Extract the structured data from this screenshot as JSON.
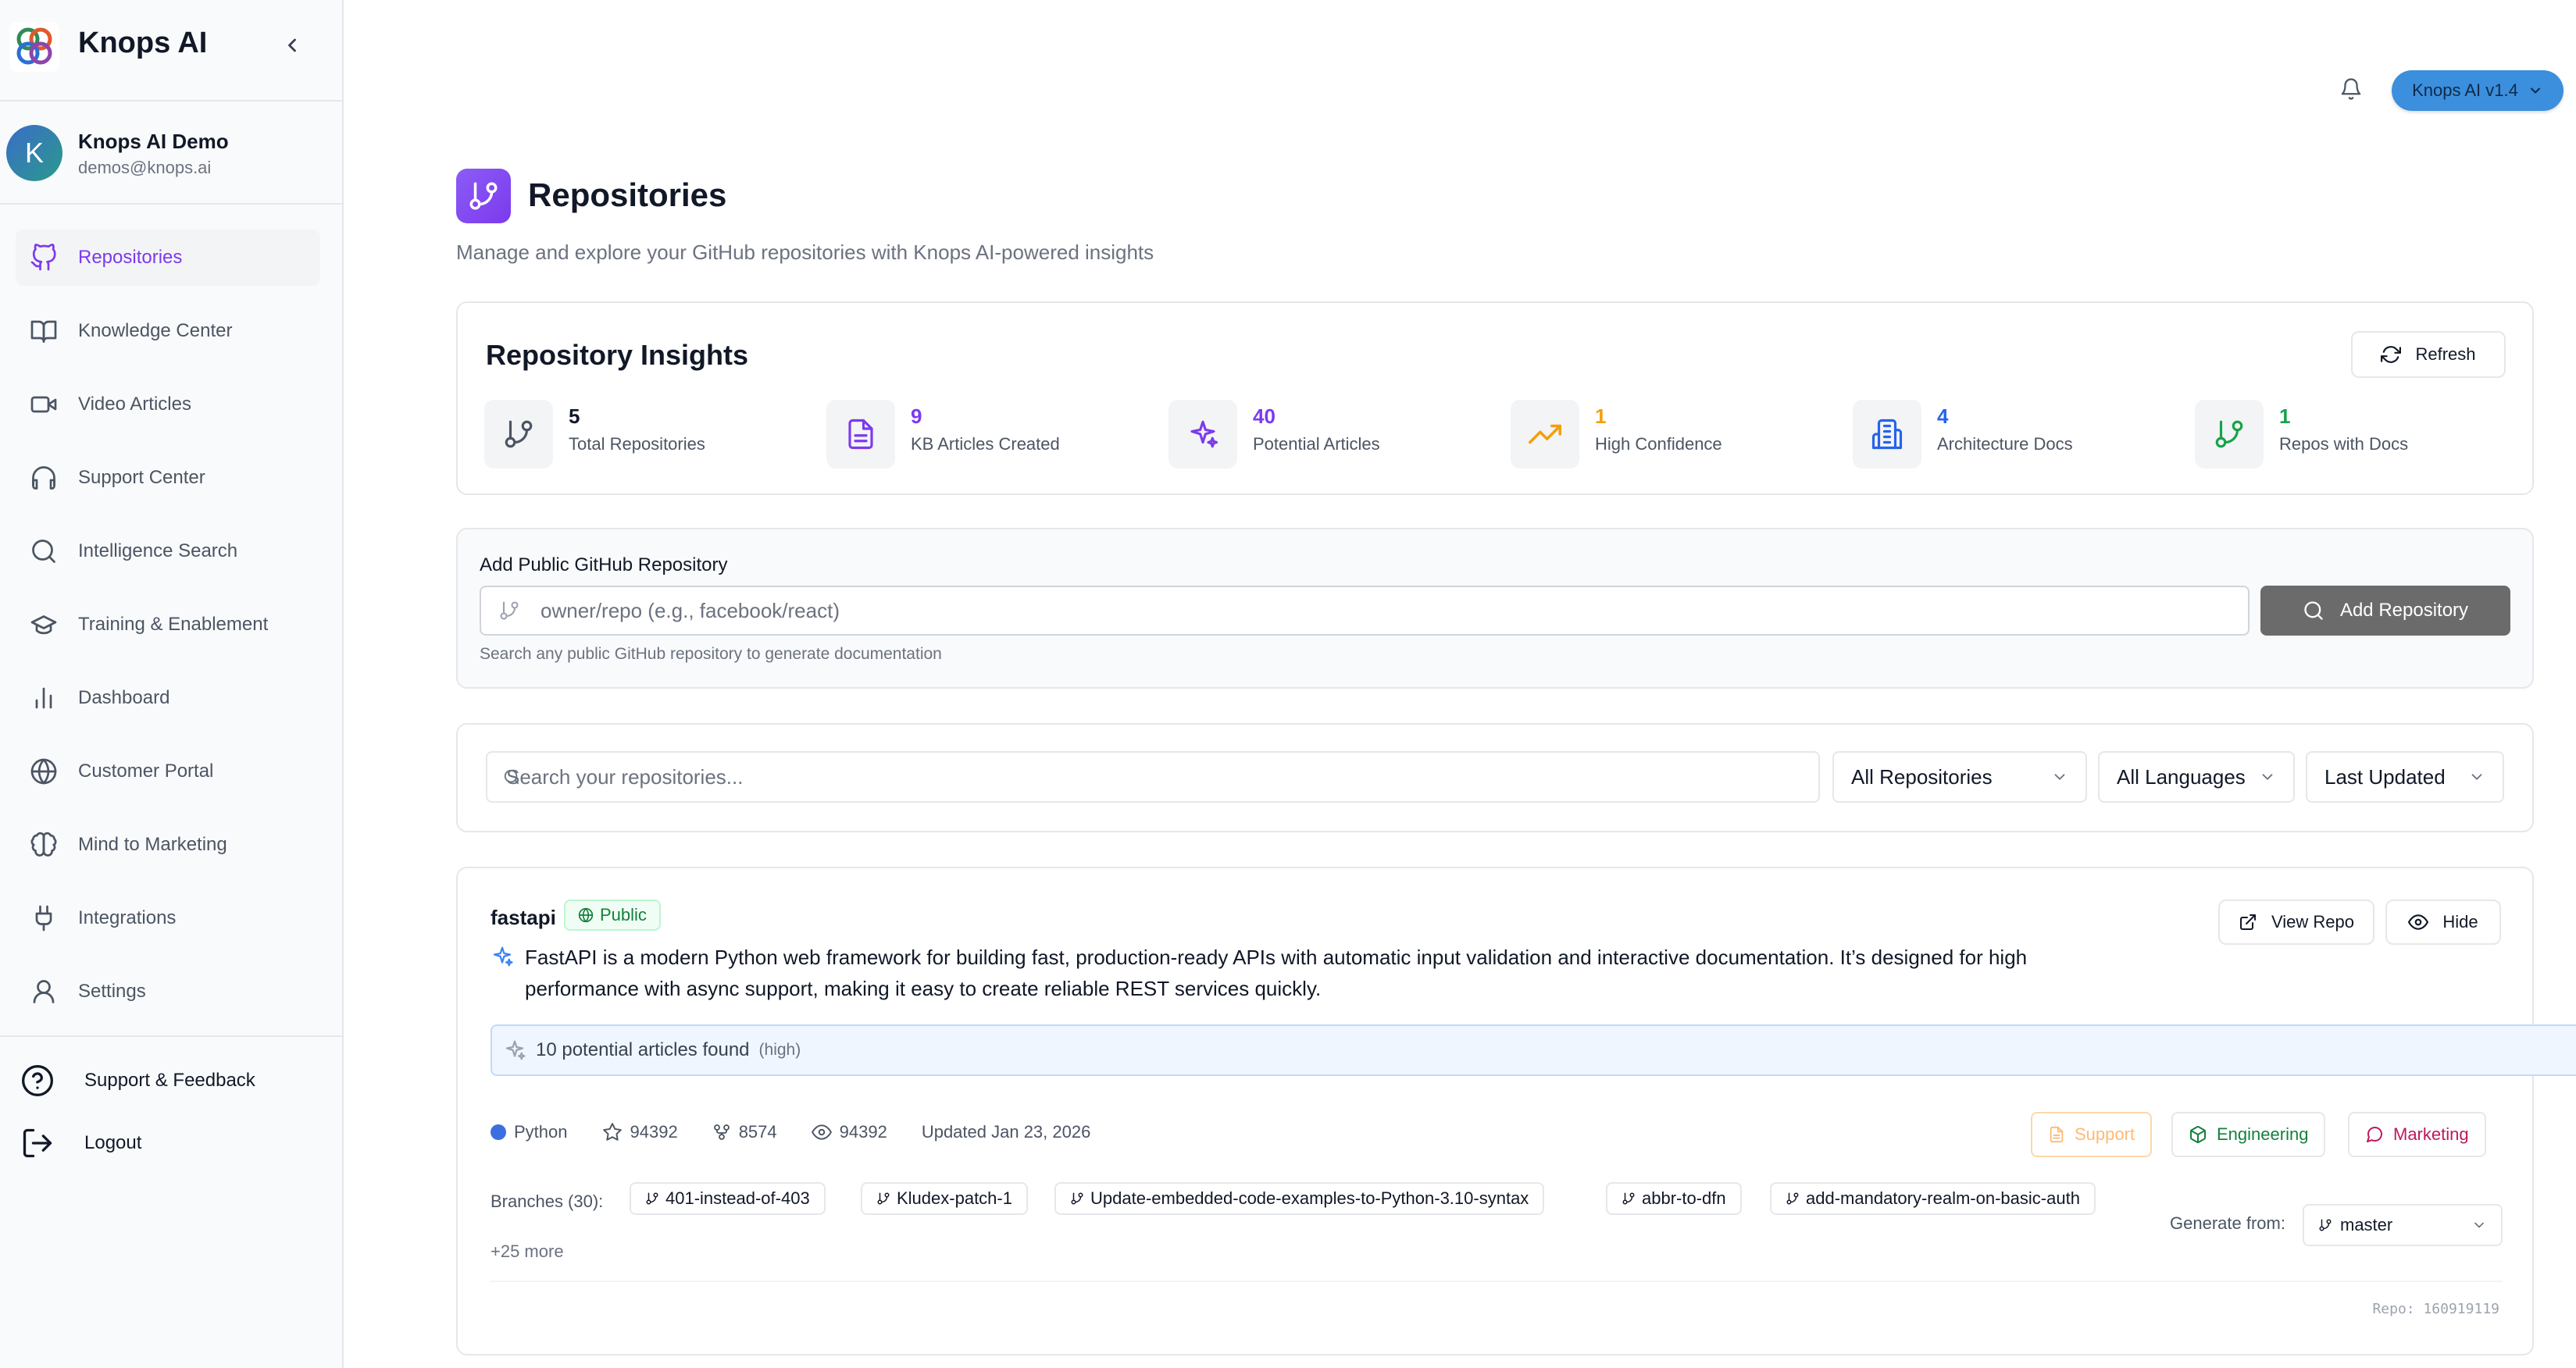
{
  "brand": {
    "name": "Knops AI"
  },
  "user": {
    "initial": "K",
    "name": "Knops AI Demo",
    "email": "demos@knops.ai"
  },
  "nav": [
    {
      "label": "Repositories",
      "icon": "github-icon",
      "active": true
    },
    {
      "label": "Knowledge Center",
      "icon": "book-icon"
    },
    {
      "label": "Video Articles",
      "icon": "video-icon"
    },
    {
      "label": "Support Center",
      "icon": "headphones-icon"
    },
    {
      "label": "Intelligence Search",
      "icon": "search-icon"
    },
    {
      "label": "Training & Enablement",
      "icon": "graduation-cap-icon"
    },
    {
      "label": "Dashboard",
      "icon": "bar-chart-icon"
    },
    {
      "label": "Customer Portal",
      "icon": "globe-icon"
    },
    {
      "label": "Mind to Marketing",
      "icon": "brain-icon"
    },
    {
      "label": "Integrations",
      "icon": "plug-icon"
    },
    {
      "label": "Settings",
      "icon": "user-icon"
    }
  ],
  "footer": {
    "support": "Support & Feedback",
    "logout": "Logout"
  },
  "topbar": {
    "version": "Knops AI v1.4"
  },
  "page": {
    "title": "Repositories",
    "subtitle": "Manage and explore your GitHub repositories with Knops AI-powered insights"
  },
  "insights": {
    "title": "Repository Insights",
    "refresh_label": "Refresh",
    "stats": [
      {
        "value": "5",
        "label": "Total Repositories",
        "color": "#111827",
        "icon": "git-branch-icon"
      },
      {
        "value": "9",
        "label": "KB Articles Created",
        "color": "#7c3aed",
        "icon": "file-text-icon"
      },
      {
        "value": "40",
        "label": "Potential Articles",
        "color": "#7c3aed",
        "icon": "sparkles-icon"
      },
      {
        "value": "1",
        "label": "High Confidence",
        "color": "#f59e0b",
        "icon": "trending-up-icon"
      },
      {
        "value": "4",
        "label": "Architecture Docs",
        "color": "#2563eb",
        "icon": "building-doc-icon"
      },
      {
        "value": "1",
        "label": "Repos with Docs",
        "color": "#16a34a",
        "icon": "git-branch-icon"
      }
    ]
  },
  "add_repo": {
    "label": "Add Public GitHub Repository",
    "placeholder": "owner/repo (e.g., facebook/react)",
    "button": "Add Repository",
    "hint": "Search any public GitHub repository to generate documentation"
  },
  "filters": {
    "search_placeholder": "Search your repositories...",
    "repo_filter": "All Repositories",
    "language_filter": "All Languages",
    "sort": "Last Updated"
  },
  "repo": {
    "name": "fastapi",
    "visibility": "Public",
    "view_repo": "View Repo",
    "hide": "Hide",
    "description": "FastAPI is a modern Python web framework for building fast, production-ready APIs with automatic input validation and interactive documentation. It’s designed for high performance with async support, making it easy to create reliable REST services quickly.",
    "found_text": "10 potential articles found",
    "found_confidence": "(high)",
    "language": "Python",
    "stars": "94392",
    "forks": "8574",
    "watchers": "94392",
    "updated": "Updated Jan 23, 2026",
    "tags": {
      "support": "Support",
      "engineering": "Engineering",
      "marketing": "Marketing"
    },
    "branches_label": "Branches (30):",
    "branches": [
      "401-instead-of-403",
      "Kludex-patch-1",
      "Update-embedded-code-examples-to-Python-3.10-syntax",
      "abbr-to-dfn",
      "add-mandatory-realm-on-basic-auth"
    ],
    "more_branches": "+25 more",
    "generate_label": "Generate from:",
    "generate_branch": "master",
    "repo_id": "Repo: 160919119"
  }
}
